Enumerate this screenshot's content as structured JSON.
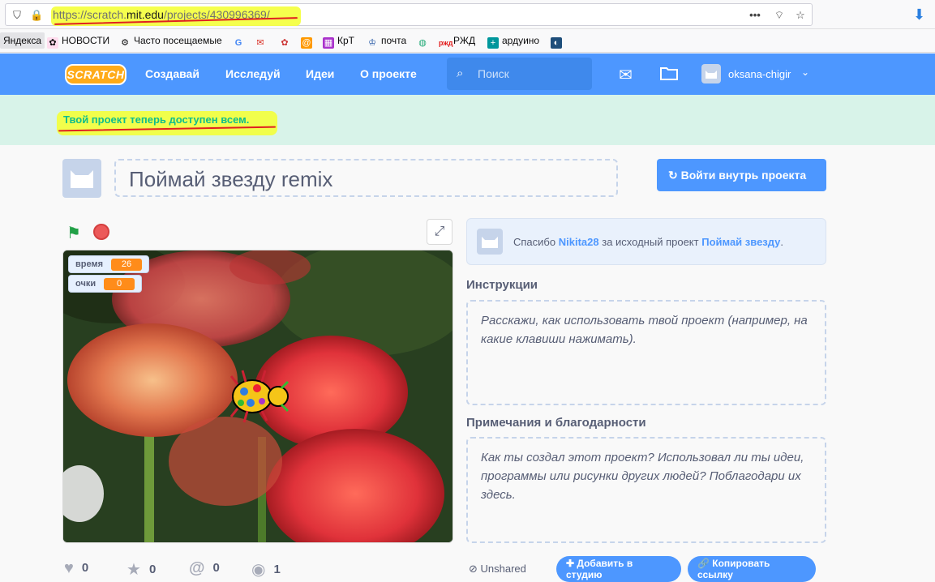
{
  "browser": {
    "url_prefix": "https://scratch.",
    "url_domain": "mit.edu",
    "url_path": "/projects/430996369/",
    "bookmarks": [
      "Яндекса",
      "НОВОСТИ",
      "Часто посещаемые",
      "КрТ",
      "почта",
      "РЖД",
      "ардуино"
    ]
  },
  "navbar": {
    "logo": "SCRATCH",
    "links": [
      "Создавай",
      "Исследуй",
      "Идеи",
      "О проекте"
    ],
    "search_placeholder": "Поиск",
    "username": "oksana-chigir"
  },
  "banner": {
    "text": "Твой проект теперь доступен всем."
  },
  "project": {
    "title": "Поймай звезду remix",
    "see_inside_label": "Войти внутрь проекта"
  },
  "stage": {
    "monitors": [
      {
        "label": "время",
        "value": "26"
      },
      {
        "label": "очки",
        "value": "0"
      }
    ]
  },
  "credit": {
    "prefix": "Спасибо",
    "author": "Nikita28",
    "middle": "за исходный проект",
    "project": "Поймай звезду",
    "suffix": "."
  },
  "instructions": {
    "title": "Инструкции",
    "placeholder": "Расскажи, как использовать твой проект (например, на какие клавиши нажимать)."
  },
  "notes": {
    "title": "Примечания и благодарности",
    "placeholder": "Как ты создал этот проект? Использовал ли ты идеи, программы или рисунки других людей? Поблагодари их здесь."
  },
  "stats": {
    "loves": "0",
    "favorites": "0",
    "remixes": "0",
    "views": "1"
  },
  "share": {
    "status": "Unshared",
    "add_to_studio": "Добавить в студию",
    "copy_link": "Копировать ссылку"
  },
  "colors": {
    "brand": "#4d97ff",
    "banner_bg": "#d8f3e9",
    "banner_text": "#0fbd8c",
    "monitor_value": "#ff8c1a",
    "highlight": "#f4ff3a"
  }
}
